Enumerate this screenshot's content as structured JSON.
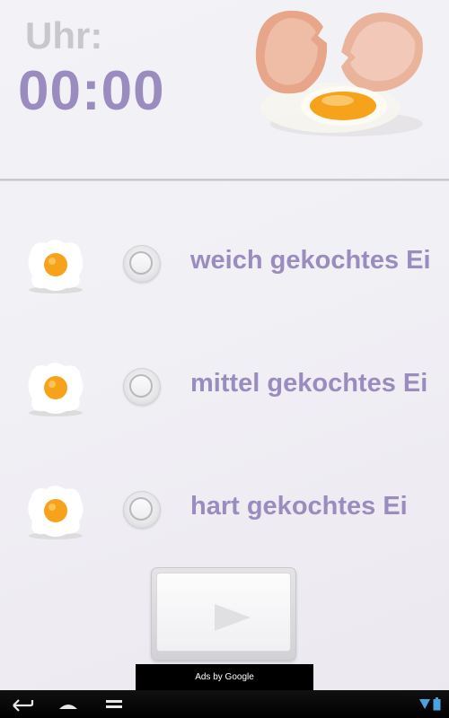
{
  "clock": {
    "label": "Uhr:",
    "time": "00:00"
  },
  "options": [
    {
      "label": "weich gekochtes Ei",
      "selected": false
    },
    {
      "label": "mittel gekochtes Ei",
      "selected": false
    },
    {
      "label": "hart gekochtes Ei",
      "selected": false
    }
  ],
  "start": {
    "icon": "play-icon"
  },
  "ad": {
    "text": "Ads by Google"
  },
  "navbar": {
    "icons": [
      "back-icon",
      "home-icon",
      "recent-apps-icon",
      "signal-icon",
      "battery-icon"
    ]
  },
  "colors": {
    "accent": "#9a8cbf",
    "label_gray": "#c8c8cc",
    "yolk": "#f6a21a",
    "navbar": "#000000"
  }
}
